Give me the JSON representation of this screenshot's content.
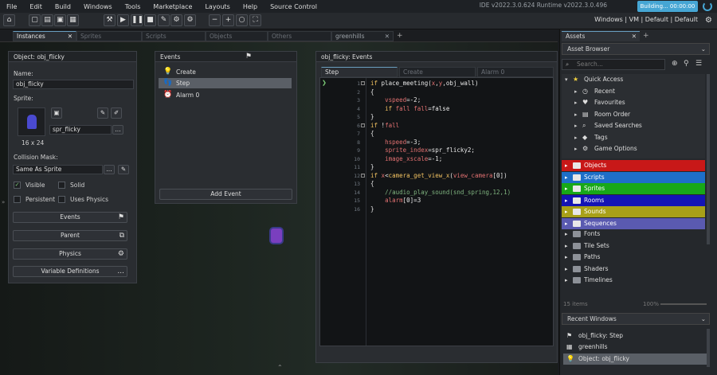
{
  "menu": [
    "File",
    "Edit",
    "Build",
    "Windows",
    "Tools",
    "Marketplace",
    "Layouts",
    "Help",
    "Source Control"
  ],
  "version": "IDE v2022.3.0.624  Runtime v2022.3.0.496",
  "build_status": "Building... 00:00:00",
  "target": "Windows | VM | Default | Default",
  "toolbar_icons": [
    "home-icon",
    "new-project-icon",
    "open-project-icon",
    "save-icon",
    "save-all-icon",
    "build-icon",
    "run-icon",
    "pause-icon",
    "stop-icon",
    "clean-icon",
    "settings-icon",
    "preferences-icon",
    "zoom-out-icon",
    "zoom-in-icon",
    "zoom-reset-icon",
    "fullscreen-icon"
  ],
  "tabs": [
    "Instances",
    "Sprites",
    "Scripts",
    "Objects",
    "Others",
    "greenhills"
  ],
  "object_panel": {
    "title": "Object: obj_flicky",
    "name_label": "Name:",
    "name_value": "obj_flicky",
    "sprite_label": "Sprite:",
    "sprite_name": "spr_flicky",
    "sprite_size": "16 x 24",
    "mask_label": "Collision Mask:",
    "mask_value": "Same As Sprite",
    "visible": "Visible",
    "solid": "Solid",
    "persistent": "Persistent",
    "uses_physics": "Uses Physics",
    "buttons": [
      "Events",
      "Parent",
      "Physics",
      "Variable Definitions"
    ],
    "dots": "..."
  },
  "events_panel": {
    "title": "Events",
    "items": [
      "Create",
      "Step",
      "Alarm 0"
    ],
    "add": "Add Event"
  },
  "code_panel": {
    "title": "obj_flicky: Events",
    "tabs": [
      "Step",
      "Create",
      "Alarm 0"
    ],
    "lines": [
      "1",
      "2",
      "3",
      "4",
      "5",
      "6",
      "7",
      "8",
      "9",
      "10",
      "11",
      "12",
      "13",
      "14",
      "15",
      "16"
    ]
  },
  "assets": {
    "tab": "Assets",
    "browser": "Asset Browser",
    "search": "Search...",
    "quick": "Quick Access",
    "quick_items": [
      "Recent",
      "Favourites",
      "Room Order",
      "Saved Searches",
      "Tags",
      "Game Options"
    ],
    "groups": [
      {
        "name": "Objects",
        "color": "#c81818"
      },
      {
        "name": "Scripts",
        "color": "#1e6fc8"
      },
      {
        "name": "Sprites",
        "color": "#18a818"
      },
      {
        "name": "Rooms",
        "color": "#1414b4"
      },
      {
        "name": "Sounds",
        "color": "#a8a018"
      },
      {
        "name": "Sequences",
        "color": "#5a5ab0"
      }
    ],
    "folders": [
      "Fonts",
      "Tile Sets",
      "Paths",
      "Shaders",
      "Timelines"
    ],
    "count": "15 items",
    "zoom": "100%",
    "recent_title": "Recent Windows",
    "recent": [
      "obj_flicky: Step",
      "greenhills",
      "Object: obj_flicky"
    ]
  }
}
